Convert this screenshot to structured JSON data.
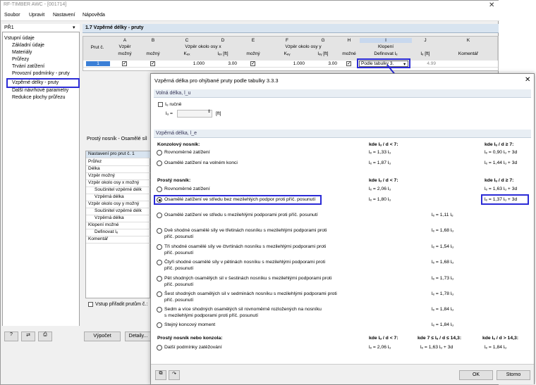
{
  "app": {
    "title": "RF-TIMBER AWC - [001714]"
  },
  "menu": [
    "Soubor",
    "Upravit",
    "Nastavení",
    "Nápověda"
  ],
  "case": "PŘ1",
  "tree": {
    "root": "Vstupní údaje",
    "items": [
      "Základní údaje",
      "Materiály",
      "Průřezy",
      "Trvání zatížení",
      "Provozní podmínky - pruty",
      "Vzpěrné délky - pruty",
      "Další návrhové parametry",
      "Redukce plochy průřezu"
    ]
  },
  "section": {
    "title": "1.7 Vzpěrné délky - pruty"
  },
  "grid": {
    "letters": [
      "A",
      "B",
      "C",
      "D",
      "E",
      "F",
      "G",
      "H",
      "I",
      "J",
      "K"
    ],
    "groups": {
      "member": "Prut č.",
      "buckling": "Vzpěr",
      "about_x": "Vzpěr okolo osy x",
      "about_y": "Vzpěr okolo osy y",
      "ltb": "Klopení",
      "defined": "Definovat lₑ"
    },
    "subheads": [
      "možný",
      "možný",
      "Kₑₓ",
      "lₑₓ [ft]",
      "možný",
      "Kₑᵧ",
      "lₑᵧ [ft]",
      "možné",
      "Definovat lₑ",
      "lₑ [ft]",
      "Komentář"
    ],
    "row": {
      "member": "1",
      "kex": "1.000",
      "lex": "3.00",
      "key": "1.000",
      "ley": "3.00",
      "le_select": "Podle tabulky 3.",
      "le": "4.99"
    }
  },
  "lower": {
    "title": "Prostý nosník - Osamělé síl",
    "props_head": "Nastavení pro prut č. 1",
    "props": [
      "Průřez",
      "Délka",
      "Vzpěr možný",
      "Vzpěr okolo osy x možný",
      "Součinitel vzpěrné délk",
      "Vzpěrná délka",
      "Vzpěr okolo osy y možný",
      "Součinitel vzpěrné délk",
      "Vzpěrná délka",
      "Klopení možné",
      "Definovat lₑ",
      "Komentář"
    ],
    "assign": "Vstup přiřadit prutům č.:"
  },
  "bottom": {
    "calc": "Výpočet",
    "details": "Detaily..."
  },
  "dialog": {
    "title": "Vzpěrná délka pro ohýbané pruty podle tabulky 3.3.3",
    "close": "✕",
    "free_length": {
      "head": "Volná délka, l_u",
      "manual": "Iᵤ ručně",
      "lu_label": "lᵤ =",
      "unit": "[ft]"
    },
    "buckling": {
      "head": "Vzpěrná délka, l_e",
      "cantilever": {
        "title": "Konzolový nosník:",
        "col1": "kde lᵤ / d < 7:",
        "col2": "kde lᵤ / d ≥ 7:",
        "rows": [
          {
            "label": "Rovnoměrné zatížení",
            "v1": "lₑ = 1,33 lᵤ",
            "v2": "lₑ = 0,90 lᵤ + 3d"
          },
          {
            "label": "Osamělé zatížení na volném konci",
            "v1": "lₑ = 1,87 lᵤ",
            "v2": "lₑ = 1,44 lᵤ + 3d"
          }
        ]
      },
      "simple": {
        "title": "Prostý nosník:",
        "col1": "kde lᵤ / d < 7:",
        "col2": "kde lᵤ / d ≥ 7:",
        "rows": [
          {
            "label": "Rovnoměrné zatížení",
            "v1": "lₑ = 2,06 lᵤ",
            "v2": "lₑ = 1,63 lᵤ + 3d"
          },
          {
            "label": "Osamělé zatížení ve středu bez mezilehlých podpor proti příč. posunutí",
            "v1": "lₑ = 1,80 lᵤ",
            "v2": "lₑ = 1,37 lᵤ + 3d"
          }
        ],
        "more": [
          {
            "label": "Osamělé zatížení ve středu s mezilehlými podporami proti příč. posunutí",
            "label2": "",
            "v": "lₑ = 1,11 lᵤ"
          },
          {
            "label": "Dvě shodné osamělé síly ve třetinách nosníku s mezilehlými podporami proti",
            "label2": "příč. posunutí",
            "v": "lₑ = 1,68 lᵤ"
          },
          {
            "label": "Tři shodné osamělé síly ve čtvrtinách nosníku s mezilehlými podporami proti",
            "label2": "příč. posunutí",
            "v": "lₑ = 1,54 lᵤ"
          },
          {
            "label": "Čtyři shodné osamělé síly v pětinách nosníku s mezilehlými podporami proti",
            "label2": "příč. posunutí",
            "v": "lₑ = 1,68 lᵤ"
          },
          {
            "label": "Pět shodných osamělých sil v šestinách nosníku s mezilehlými podporami proti",
            "label2": "příč. posunutí",
            "v": "lₑ = 1,73 lᵤ"
          },
          {
            "label": "Šest shodných osamělých sil v sedminách nosníku s mezilehlými podporami proti",
            "label2": "příč. posunutí",
            "v": "lₑ = 1,78 lᵤ"
          },
          {
            "label": "Sedm a více shodných osamělých sil rovnoměrně rozložených na nosníku",
            "label2": "s mezilehlými podporami proti příč. posunutí",
            "v": "lₑ = 1,84 lᵤ"
          },
          {
            "label": "Stejný koncový moment",
            "label2": "",
            "v": "lₑ = 1,84 lᵤ"
          }
        ]
      },
      "other": {
        "title": "Prostý nosník nebo konzola:",
        "col1": "kde lᵤ / d < 7:",
        "col2": "kde 7 ≤ lᵤ / d ≤ 14,3:",
        "col3": "kde lᵤ / d > 14,3:",
        "label": "Další podmínky zatěžování",
        "v1": "lₑ = 2,06 lᵤ",
        "v2": "lₑ = 1,63 lᵤ + 3d",
        "v3": "lₑ = 1,84 lᵤ"
      }
    },
    "ok": "OK",
    "cancel": "Storno"
  },
  "colors": {
    "highlight": "#2b2bd6",
    "header_bg": "#d8e4f0",
    "section_bg": "#e8eef4"
  }
}
